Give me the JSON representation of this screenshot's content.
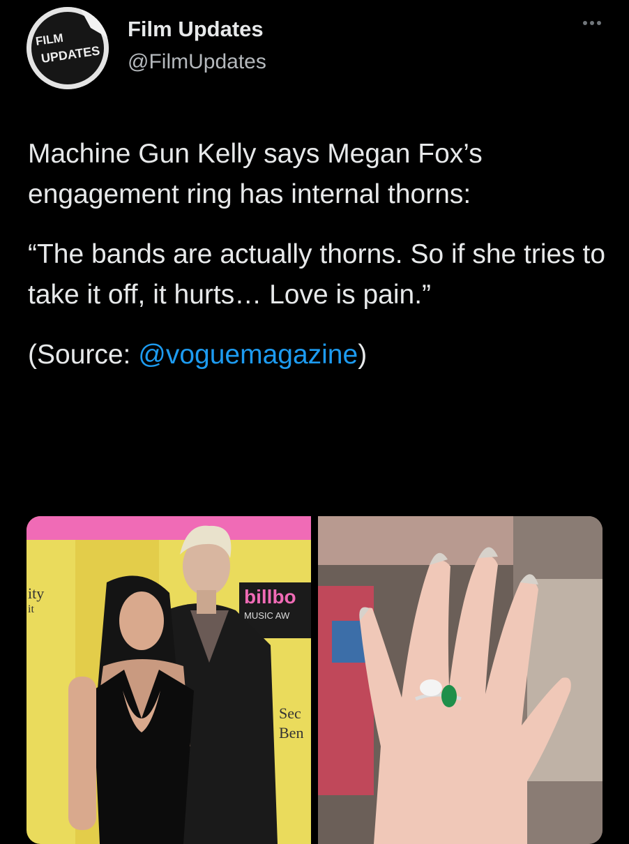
{
  "author": {
    "display_name": "Film Updates",
    "handle": "@FilmUpdates",
    "avatar_icon": "film-updates-logo-icon",
    "avatar_logo_text": [
      "FILM",
      "UPDATES"
    ]
  },
  "menu": {
    "more_icon": "ellipsis-icon"
  },
  "tweet": {
    "paragraph_1": "Machine Gun Kelly says Megan Fox’s engagement ring has internal thorns:",
    "paragraph_2": "“The bands are actually thorns. So if she tries to take it off, it hurts… Love is pain.”",
    "source_prefix": "(Source: ",
    "source_mention": "@voguemagazine",
    "source_suffix": ")"
  },
  "media": {
    "photos": [
      {
        "subject": "red-carpet-couple-photo",
        "backdrop_text": [
          "billbo",
          "MUSIC AW",
          "ity",
          "it",
          "Sec",
          "Ben"
        ]
      },
      {
        "subject": "engagement-ring-hand-photo"
      }
    ],
    "colors": {
      "backdrop_yellow": "#eadb5c",
      "backdrop_pink": "#f06bb6",
      "emerald": "#1f8f4a"
    }
  }
}
